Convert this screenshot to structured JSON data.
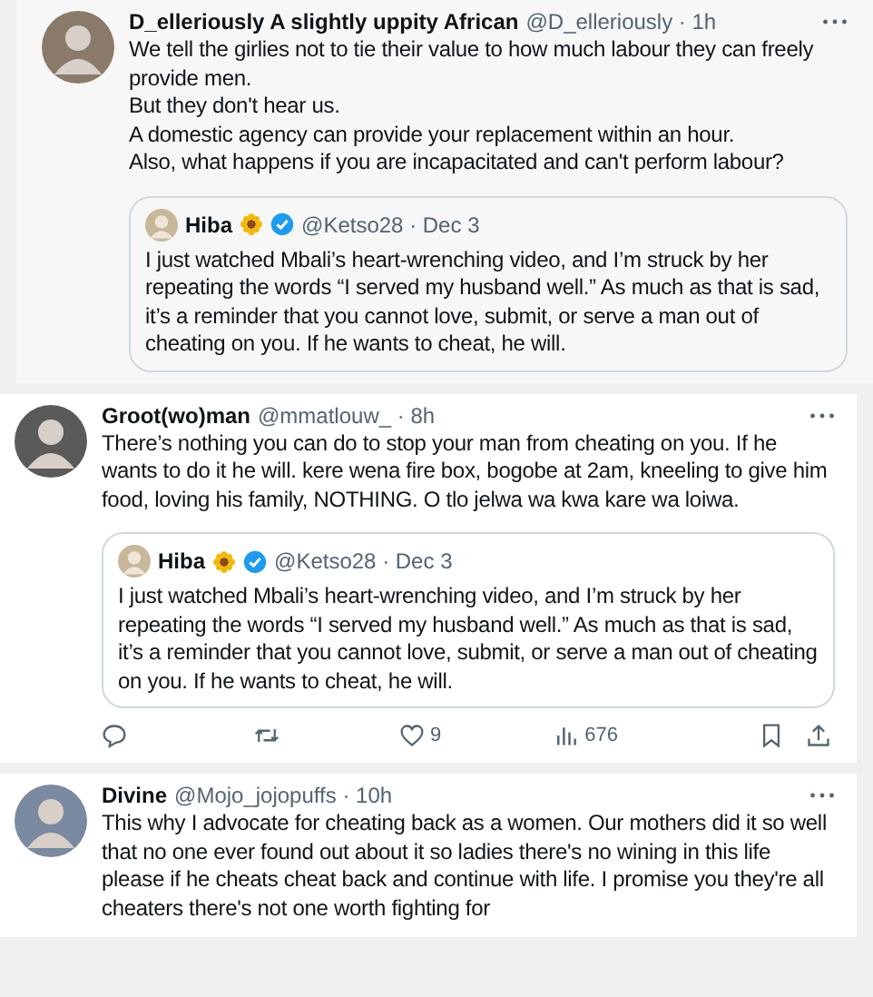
{
  "tweets": [
    {
      "name": "D_elleriously A slightly uppity African",
      "handle": "@D_elleriously",
      "time": "· 1h",
      "paragraphs": [
        "We tell the girlies not to tie their value to how much labour they can freely provide men.",
        "But they don't hear us.",
        "A domestic agency can provide your replacement within an hour.",
        "Also, what happens if you are incapacitated and can't perform labour?"
      ],
      "quote": {
        "name": "Hiba",
        "verified": true,
        "handle": "@Ketso28",
        "time": "· Dec 3",
        "text": "I just watched Mbali’s heart-wrenching video, and I’m struck by her repeating the words “I served my husband well.” As much as that is sad, it’s a reminder that you cannot love, submit, or serve a man out of cheating on you. If he wants to cheat, he will."
      }
    },
    {
      "name": "Groot(wo)man",
      "handle": "@mmatlouw_",
      "time": "· 8h",
      "paragraphs": [
        "There’s nothing you can do to stop your man from cheating on you. If he wants to do it he will. kere wena fire box, bogobe at 2am, kneeling to give him food, loving his family, NOTHING. O tlo jelwa wa kwa kare wa loiwa."
      ],
      "quote": {
        "name": "Hiba",
        "verified": true,
        "handle": "@Ketso28",
        "time": "· Dec 3",
        "text": "I just watched Mbali’s heart-wrenching video, and I’m struck by her repeating the words “I served my husband well.” As much as that is sad, it’s a reminder that you cannot love, submit, or serve a man out of cheating on you. If he wants to cheat, he will."
      },
      "actions": {
        "likes": "9",
        "views": "676"
      }
    },
    {
      "name": "Divine",
      "handle": "@Mojo_jojopuffs",
      "time": "· 10h",
      "paragraphs": [
        "This why I advocate for cheating back as a women. Our mothers did it so well that no one ever found out about it so ladies there's no wining in this life please if he cheats cheat back and continue with life. I promise you they're all cheaters there's not one worth fighting for"
      ]
    }
  ]
}
